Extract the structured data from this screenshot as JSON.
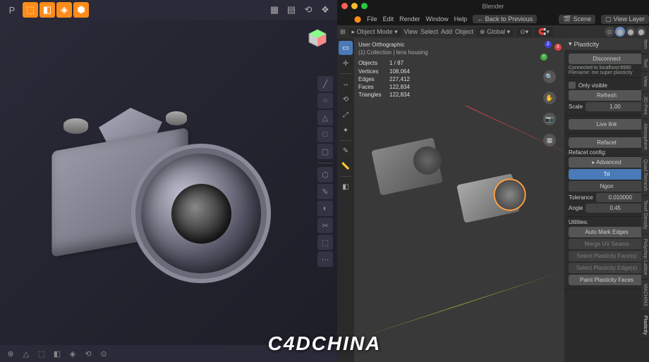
{
  "watermark": "C4DCHINA",
  "plasticity": {
    "toolbar": {
      "logo": "P",
      "sel_modes": [
        "⬚",
        "◧",
        "◈",
        "⬢"
      ],
      "view_group": [
        "▦",
        "▤",
        "⟲",
        "❖"
      ]
    },
    "vert_tools": [
      "╱",
      "○",
      "△",
      "□",
      "▢",
      "⬡",
      "✎",
      "◐",
      "✂",
      "⬚",
      "⋯"
    ],
    "bottom": [
      "⊕",
      "△",
      "⬚",
      "◧",
      "◈",
      "⟲",
      "⊙"
    ]
  },
  "blender": {
    "title": "Blender",
    "menu": [
      "File",
      "Edit",
      "Render",
      "Window",
      "Help"
    ],
    "back_btn": "← Back to Previous",
    "scene_dd": "Scene",
    "layer_dd": "View Layer",
    "header2": {
      "mode": "Object Mode",
      "menus": [
        "View",
        "Select",
        "Add",
        "Object"
      ],
      "orient": "Global"
    },
    "collection_path": "Collection | lens housing",
    "projection": "User Orthographic",
    "stats": [
      {
        "k": "Objects",
        "v": "1 / 87"
      },
      {
        "k": "Vertices",
        "v": "108,064"
      },
      {
        "k": "Edges",
        "v": "227,412"
      },
      {
        "k": "Faces",
        "v": "122,834"
      },
      {
        "k": "Triangles",
        "v": "122,834"
      }
    ],
    "panel": {
      "title": "Plasticity",
      "disconnect": "Disconnect",
      "connected": "Connected to localhost:8980",
      "filename": "Filename: me super plasticity",
      "only_visible": "Only visible",
      "refresh": "Refresh",
      "scale_lbl": "Scale",
      "scale_val": "1.00",
      "live_link": "Live link",
      "refacet": "Refacet",
      "refacet_config": "Refacet config:",
      "advanced": "Advanced",
      "tri": "Tri",
      "ngon": "Ngon",
      "tol_lbl": "Tolerance",
      "tol_val": "0.010000",
      "angle_lbl": "Angle",
      "angle_val": "0.45",
      "utilities": "Utilities:",
      "auto_mark": "Auto Mark Edges",
      "merge_uv": "Merge UV Seams",
      "select_groups": "Select Plasticity Face(s)",
      "select_edges": "Select Plasticity Edge(s)",
      "paint": "Paint Plasticity Faces"
    },
    "vtabs": [
      "Item",
      "Tool",
      "View",
      "3D-Print",
      "Atmosphere",
      "Quad Remesh",
      "Texel Density",
      "Polychop Lattice",
      "MACHIN3",
      "Plasticity"
    ]
  }
}
